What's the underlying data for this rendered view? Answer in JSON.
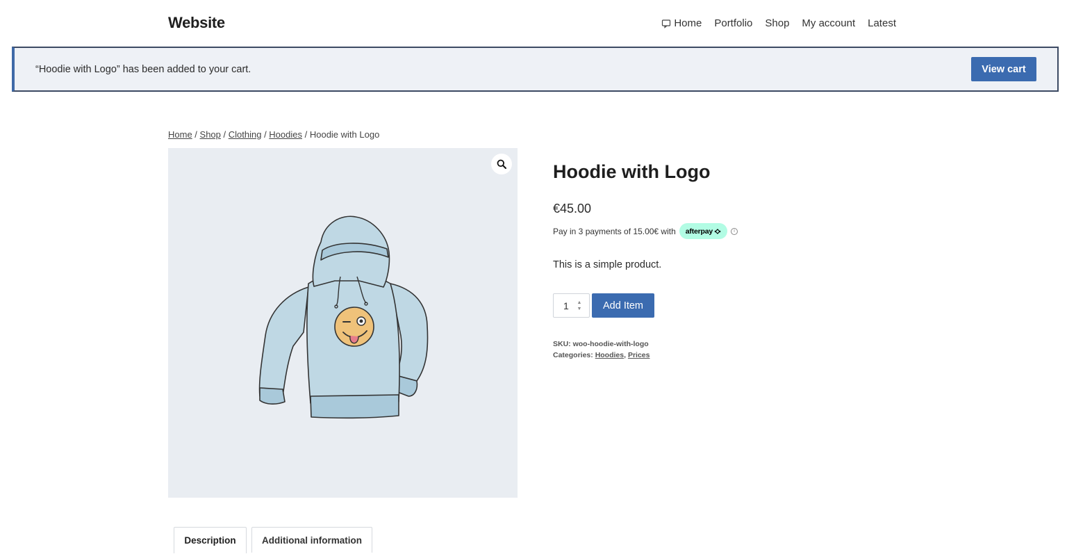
{
  "site": {
    "title": "Website"
  },
  "nav": {
    "items": [
      {
        "label": "Home"
      },
      {
        "label": "Portfolio"
      },
      {
        "label": "Shop"
      },
      {
        "label": "My account"
      },
      {
        "label": "Latest"
      }
    ]
  },
  "notice": {
    "message": "“Hoodie with Logo” has been added to your cart.",
    "button_label": "View cart"
  },
  "breadcrumb": {
    "items": [
      "Home",
      "Shop",
      "Clothing",
      "Hoodies"
    ],
    "current": "Hoodie with Logo",
    "separator": " / "
  },
  "product": {
    "title": "Hoodie with Logo",
    "price": "€45.00",
    "afterpay_text": "Pay in 3 payments of 15.00€ with",
    "afterpay_logo": "afterpay",
    "short_description": "This is a simple product.",
    "quantity": "1",
    "add_button": "Add Item",
    "sku_label": "SKU:",
    "sku": "woo-hoodie-with-logo",
    "categories_label": "Categories:",
    "categories": [
      "Hoodies",
      "Prices"
    ]
  },
  "tabs": [
    {
      "label": "Description",
      "active": true
    },
    {
      "label": "Additional information",
      "active": false
    }
  ],
  "colors": {
    "accent": "#3b6bb0",
    "notice_bg": "#eef1f6",
    "afterpay_badge": "#b2fce4",
    "gallery_bg": "#e9edf2"
  }
}
